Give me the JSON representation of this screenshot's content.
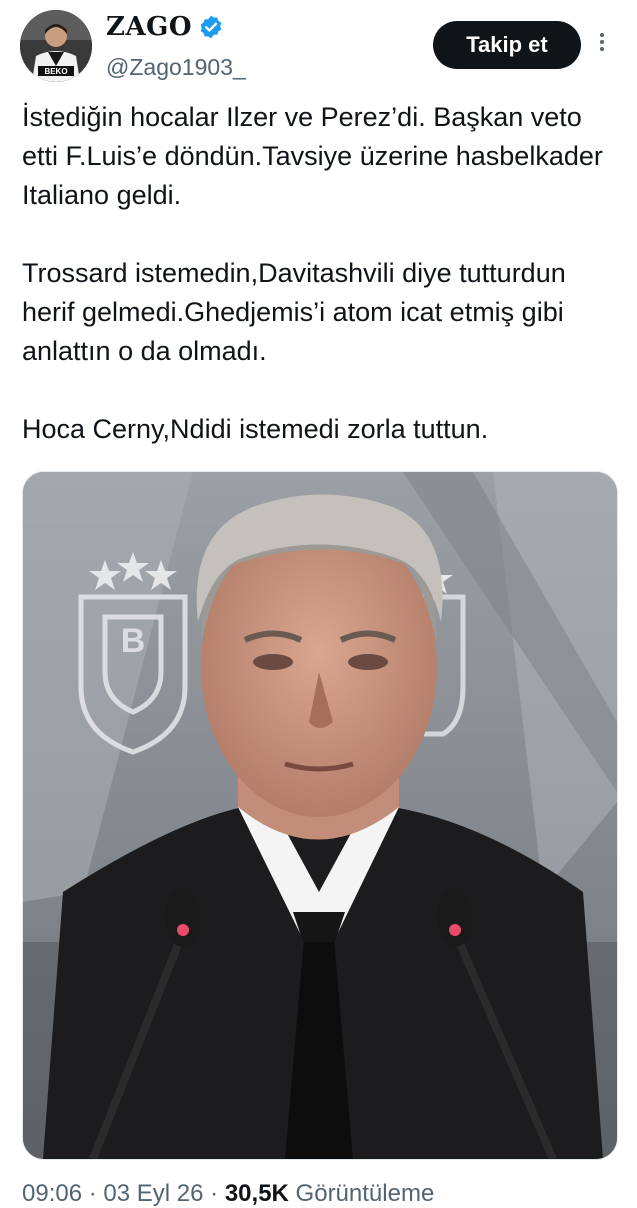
{
  "profile": {
    "display_name": "ZAGO",
    "handle": "@Zago1903_",
    "avatar_badge_text": "BEKO",
    "verified": true
  },
  "actions": {
    "follow_label": "Takip et"
  },
  "tweet": {
    "paragraphs": [
      "İstediğin hocalar Ilzer ve Perez’di. Başkan veto etti F.Luis’e döndün.Tavsiye üzerine hasbelkader Italiano geldi.",
      "Trossard istemedin,Davitashvili diye tutturdun herif gelmedi.Ghedjemis’i atom icat etmiş gibi anlattın o da olmadı.",
      "Hoca Cerny,Ndidi istemedi zorla tuttun."
    ],
    "media_alt": "Photo of an older man in a dark suit and black tie speaking at a press conference with two microphones in front of him; a club crest with stars is on the grey backdrop behind him.",
    "meta": {
      "time": "09:06",
      "date": "03 Eyl 26",
      "separator": "·",
      "views_count": "30,5K",
      "views_label": "Görüntüleme"
    }
  },
  "colors": {
    "text": "#0f1419",
    "secondary": "#536471",
    "button_bg": "#0f1419",
    "verified_blue": "#1d9bf0"
  }
}
